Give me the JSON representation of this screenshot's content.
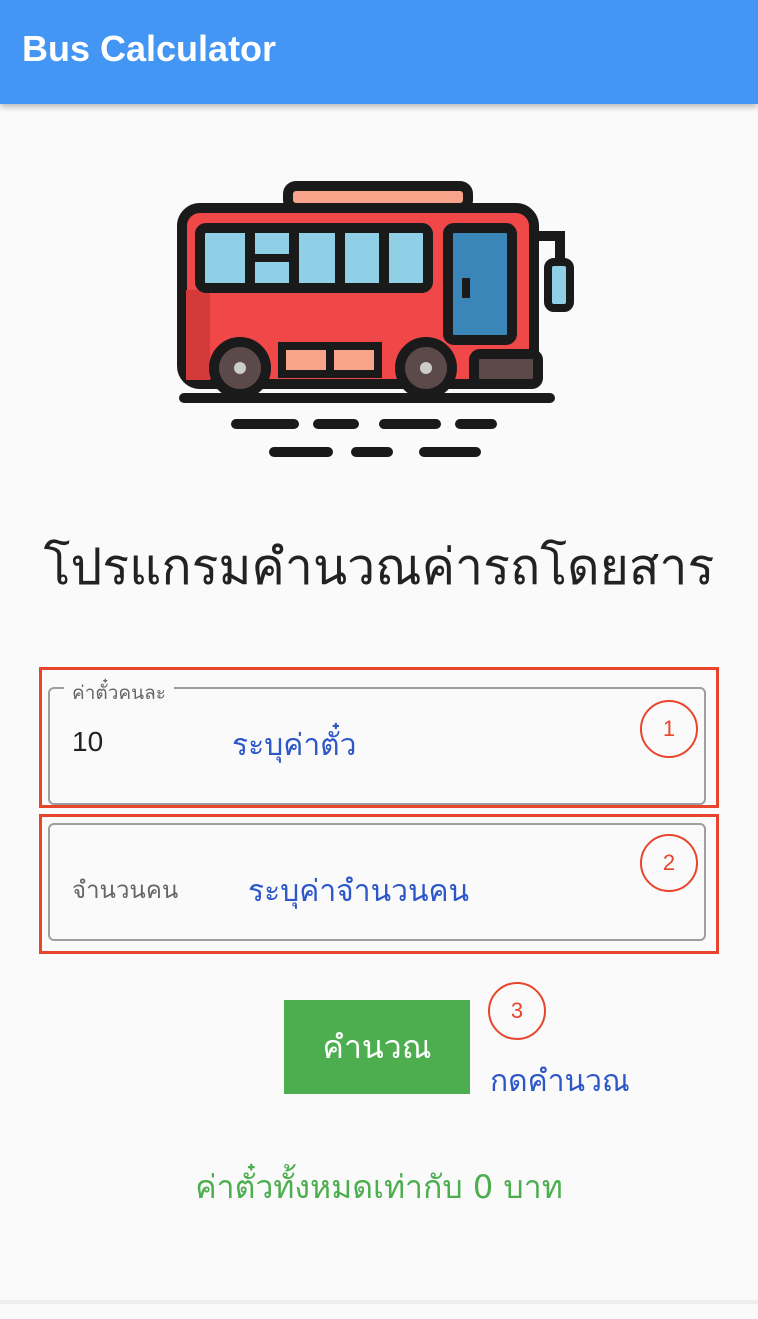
{
  "appbar": {
    "title": "Bus Calculator",
    "color": "#4396f3"
  },
  "illustration": {
    "icon": "bus-icon"
  },
  "heading": "โปรแกรมคำนวณค่ารถโดยสาร",
  "fare_field": {
    "label": "ค่าตั๋วคนละ",
    "value": "10",
    "hint": "ระบุค่าตั๋ว",
    "step": "1"
  },
  "people_field": {
    "placeholder": "จำนวนคน",
    "hint": "ระบุค่าจำนวนคน",
    "step": "2"
  },
  "calculate": {
    "label": "คำนวณ",
    "hint": "กดคำนวณ",
    "step": "3",
    "color": "#4cae4f"
  },
  "result": "ค่าตั๋วทั้งหมดเท่ากับ 0 บาท",
  "annotation_color": "#e8452c",
  "hint_color": "#2d56c9"
}
